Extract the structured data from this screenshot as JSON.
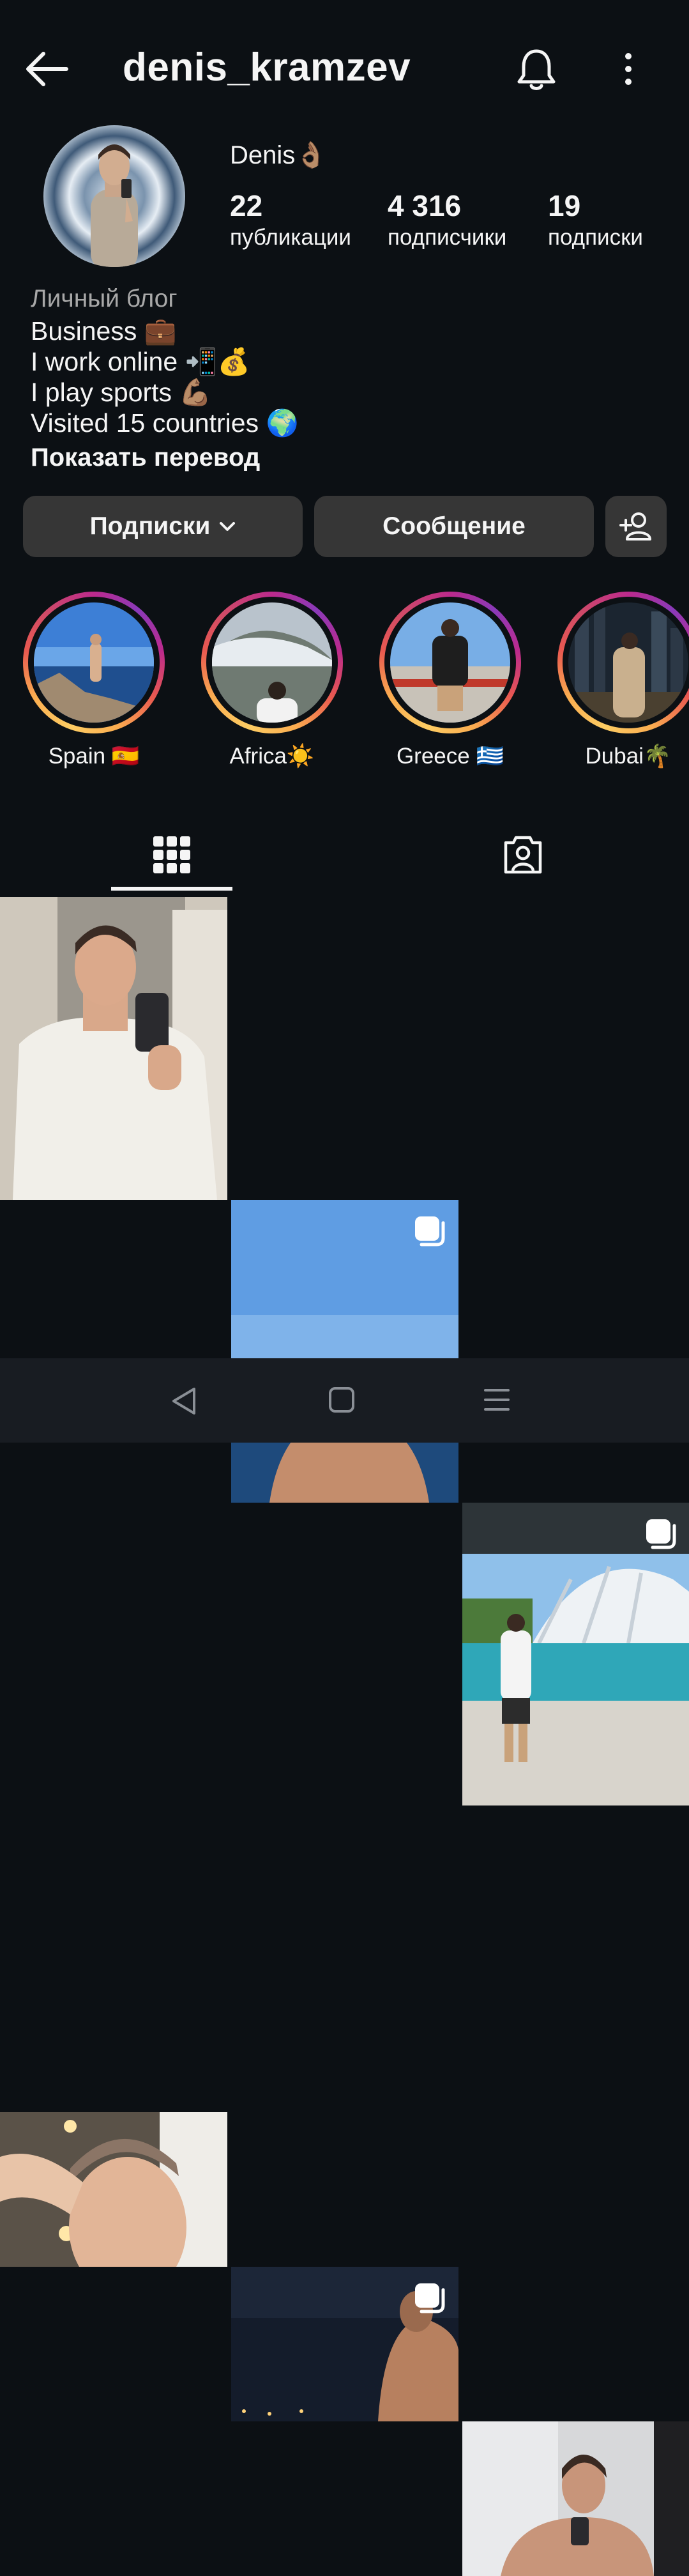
{
  "header": {
    "username": "denis_kramzev",
    "icons": {
      "back": "arrow-left-icon",
      "notifications": "bell-icon",
      "more": "more-vertical-icon"
    }
  },
  "profile": {
    "display_name": "Denis👌🏽",
    "stats": {
      "posts": {
        "count": "22",
        "label": "публикации"
      },
      "followers": {
        "count": "4 316",
        "label": "подписчики"
      },
      "following": {
        "count": "19",
        "label": "подписки"
      }
    },
    "category": "Личный блог",
    "bio": [
      "Business 💼",
      "I work online 📲💰",
      "I play sports 💪🏽",
      "Visited 15 countries 🌍"
    ],
    "show_translation": "Показать перевод"
  },
  "actions": {
    "following": "Подписки",
    "message": "Сообщение",
    "add_icon": "add-person-icon"
  },
  "highlights": [
    {
      "label": "Spain 🇪🇸"
    },
    {
      "label": "Africa☀️"
    },
    {
      "label": "Greece 🇬🇷"
    },
    {
      "label": "Dubai🌴"
    }
  ],
  "tabs": {
    "grid_icon": "grid-icon",
    "tagged_icon": "tagged-person-icon",
    "active": "grid"
  },
  "posts": [
    {
      "multiple": false
    },
    {
      "multiple": true
    },
    {
      "multiple": true
    },
    {
      "multiple": false
    },
    {
      "multiple": true
    },
    {
      "multiple": false
    }
  ],
  "nav": {
    "back": "nav-back-icon",
    "home": "nav-home-icon",
    "recents": "nav-recents-icon"
  },
  "colors": {
    "background": "#0c1014",
    "button": "#363636",
    "secondary_text": "#a8a8a8"
  }
}
